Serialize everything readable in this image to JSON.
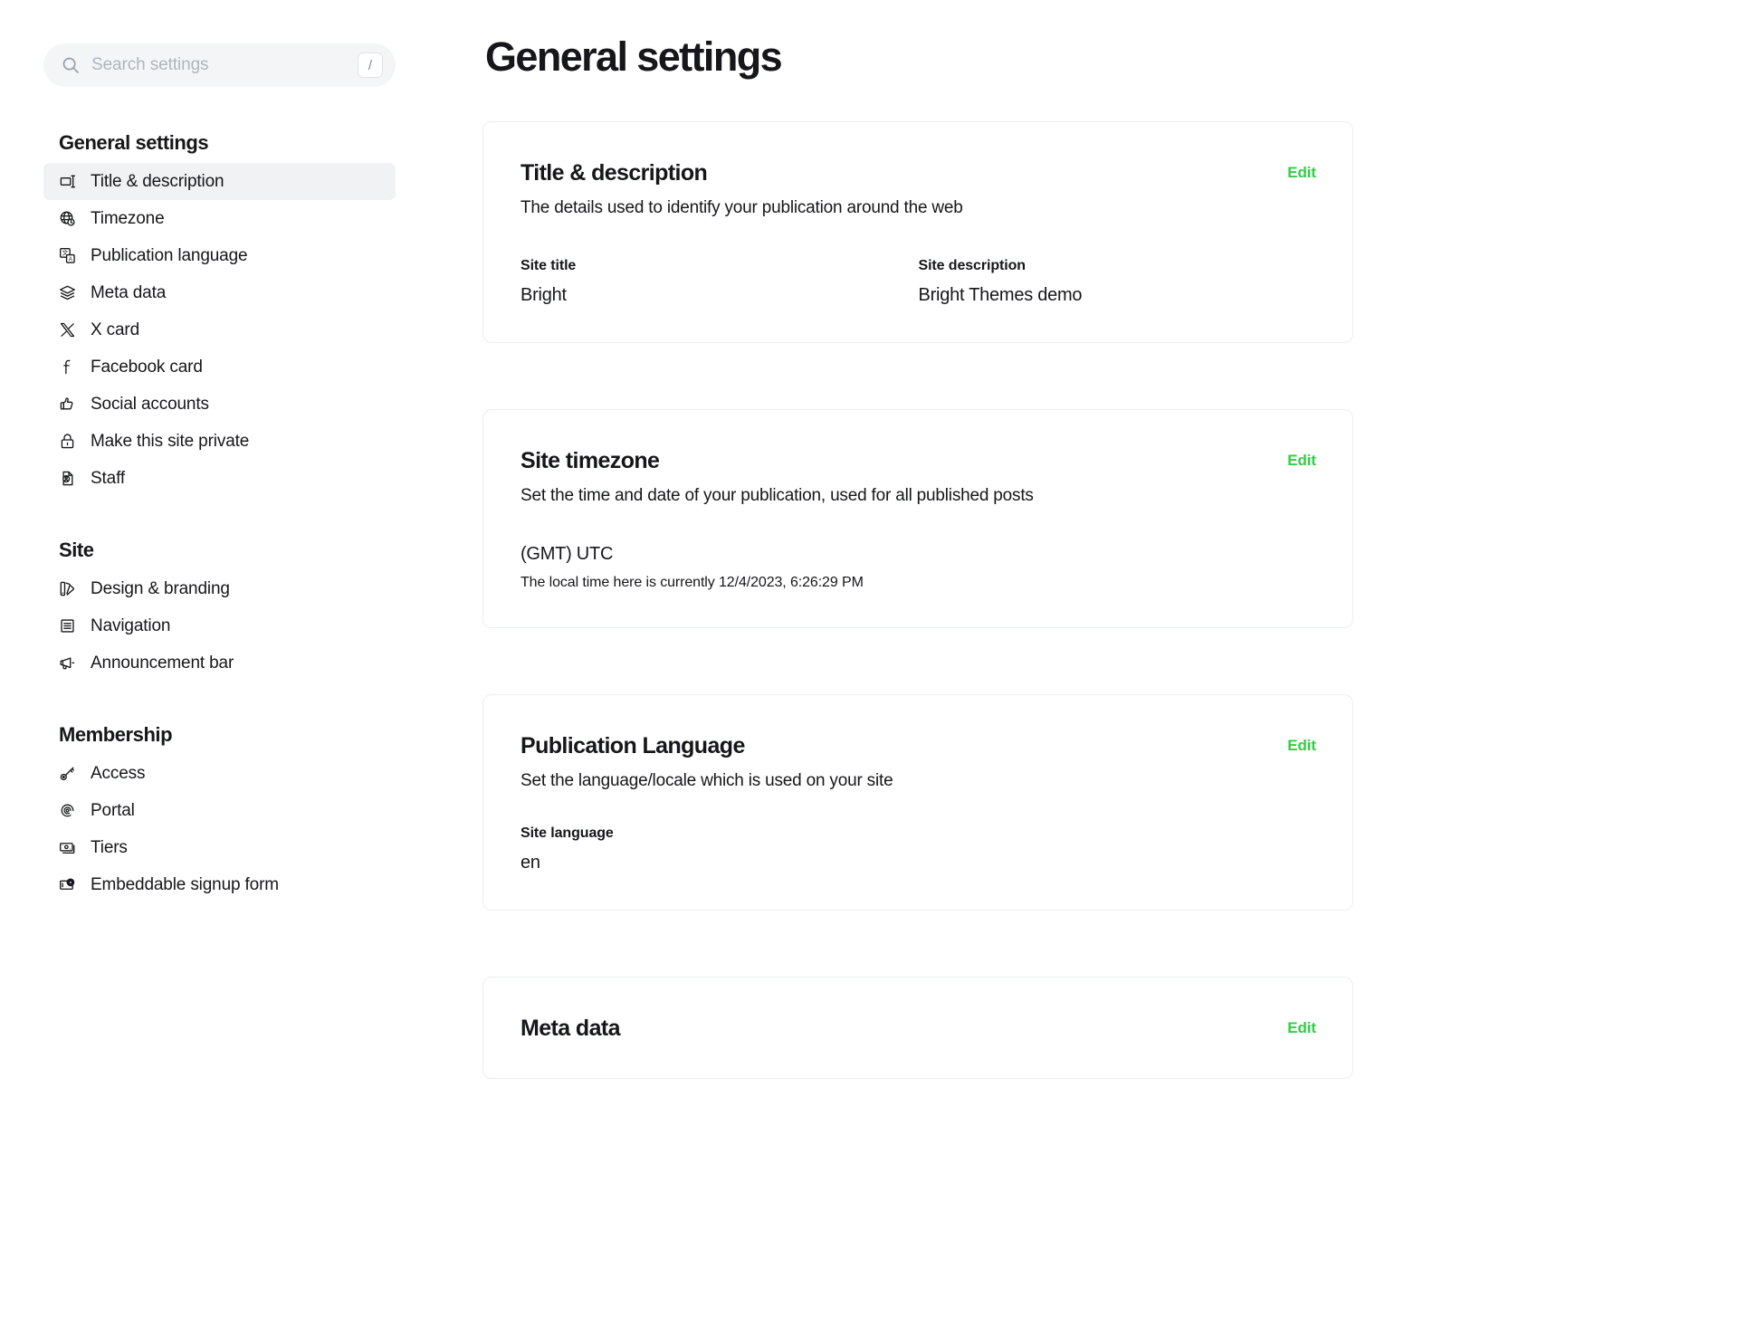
{
  "search": {
    "placeholder": "Search settings",
    "value": "",
    "shortcut": "/"
  },
  "sidebar": {
    "groups": [
      {
        "title": "General settings",
        "items": [
          {
            "label": "Title & description",
            "icon": "title-description-icon",
            "active": true
          },
          {
            "label": "Timezone",
            "icon": "globe-clock-icon",
            "active": false
          },
          {
            "label": "Publication language",
            "icon": "translate-icon",
            "active": false
          },
          {
            "label": "Meta data",
            "icon": "layers-icon",
            "active": false
          },
          {
            "label": "X card",
            "icon": "x-logo-icon",
            "active": false
          },
          {
            "label": "Facebook card",
            "icon": "facebook-icon",
            "active": false
          },
          {
            "label": "Social accounts",
            "icon": "thumbs-up-icon",
            "active": false
          },
          {
            "label": "Make this site private",
            "icon": "lock-icon",
            "active": false
          },
          {
            "label": "Staff",
            "icon": "staff-document-icon",
            "active": false
          }
        ]
      },
      {
        "title": "Site",
        "items": [
          {
            "label": "Design & branding",
            "icon": "palette-icon",
            "active": false
          },
          {
            "label": "Navigation",
            "icon": "navigation-list-icon",
            "active": false
          },
          {
            "label": "Announcement bar",
            "icon": "megaphone-icon",
            "active": false
          }
        ]
      },
      {
        "title": "Membership",
        "items": [
          {
            "label": "Access",
            "icon": "key-icon",
            "active": false
          },
          {
            "label": "Portal",
            "icon": "portal-icon",
            "active": false
          },
          {
            "label": "Tiers",
            "icon": "banknote-icon",
            "active": false
          },
          {
            "label": "Embeddable signup form",
            "icon": "embed-signup-icon",
            "active": false
          }
        ]
      }
    ]
  },
  "main": {
    "page_title": "General settings",
    "cards": {
      "title_description": {
        "title": "Title & description",
        "description": "The details used to identify your publication around the web",
        "edit_label": "Edit",
        "site_title_label": "Site title",
        "site_title_value": "Bright",
        "site_description_label": "Site description",
        "site_description_value": "Bright Themes demo"
      },
      "timezone": {
        "title": "Site timezone",
        "description": "Set the time and date of your publication, used for all published posts",
        "edit_label": "Edit",
        "value": "(GMT) UTC",
        "local_time": "The local time here is currently 12/4/2023, 6:26:29 PM"
      },
      "language": {
        "title": "Publication Language",
        "description": "Set the language/locale which is used on your site",
        "edit_label": "Edit",
        "site_language_label": "Site language",
        "site_language_value": "en"
      },
      "metadata": {
        "title": "Meta data",
        "edit_label": "Edit"
      }
    }
  },
  "colors": {
    "accent_green": "#30cf43",
    "text": "#15171a",
    "muted": "#aeb6be",
    "card_border": "#ebeef0",
    "active_bg": "#f1f2f3",
    "search_bg": "#f4f5f6"
  }
}
